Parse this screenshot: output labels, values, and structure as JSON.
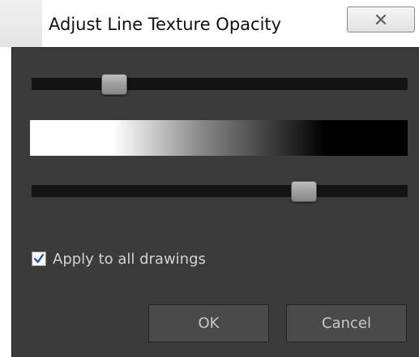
{
  "dialog": {
    "title": "Adjust Line Texture Opacity",
    "close_icon": "close-x-icon"
  },
  "sliders": {
    "top": {
      "value": 0.2
    },
    "bottom": {
      "value": 0.74
    }
  },
  "gradient": {
    "colors": [
      "#ffffff",
      "#000000"
    ]
  },
  "options": {
    "apply_all": {
      "label": "Apply to all drawings",
      "checked": true
    }
  },
  "buttons": {
    "ok_label": "OK",
    "cancel_label": "Cancel"
  },
  "colors": {
    "panel": "#3b3b3b",
    "track": "#141414",
    "check": "#1f4fae"
  }
}
